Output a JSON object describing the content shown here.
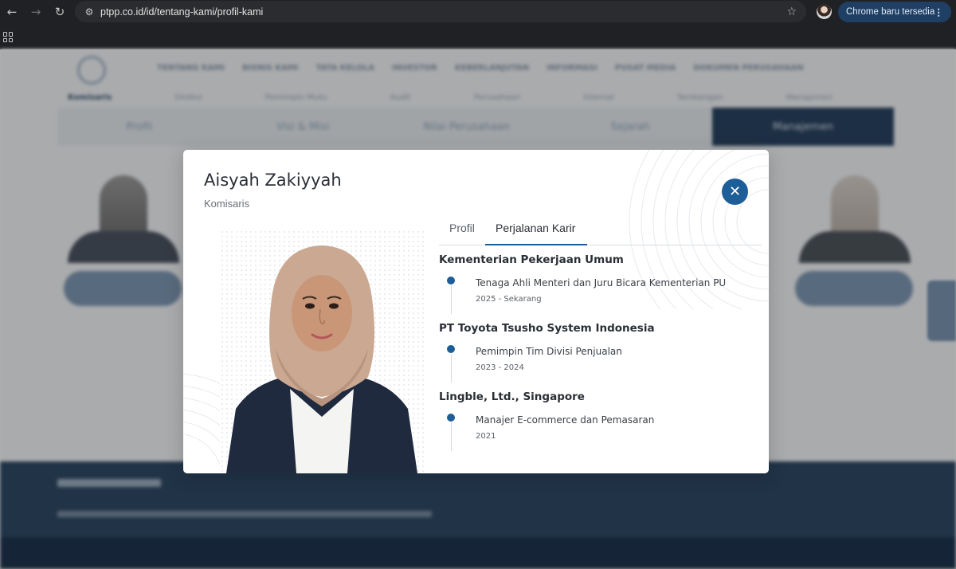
{
  "browser": {
    "url": "ptpp.co.id/id/tentang-kami/profil-kami",
    "update_label": "Chrome baru tersedia"
  },
  "site_nav": {
    "items": [
      "TENTANG KAMI",
      "BISNIS KAMI",
      "TATA KELOLA",
      "INVESTOR",
      "KEBERLANJUTAN",
      "INFORMASI",
      "PUSAT MEDIA",
      "DOKUMEN PERUSAHAAN"
    ],
    "sub_items": [
      "Komisaris",
      "Direksi",
      "Pemimpin Mutu",
      "Audit",
      "Perusahaan",
      "Internal",
      "Tambangan",
      "Manajemen"
    ],
    "tabs": [
      "Profil",
      "Visi & Misi",
      "Nilai Perusahaan",
      "Sejarah",
      "Manajemen"
    ]
  },
  "modal": {
    "name": "Aisyah Zakiyyah",
    "role": "Komisaris",
    "tabs": [
      {
        "label": "Profil",
        "active": false
      },
      {
        "label": "Perjalanan Karir",
        "active": true
      }
    ],
    "career": [
      {
        "company": "Kementerian Pekerjaan Umum",
        "position": "Tenaga Ahli Menteri dan Juru Bicara Kementerian PU",
        "period": "2025 - Sekarang"
      },
      {
        "company": "PT Toyota Tsusho System Indonesia",
        "position": "Pemimpin Tim Divisi Penjualan",
        "period": "2023 - 2024"
      },
      {
        "company": "Lingble, Ltd., Singapore",
        "position": "Manajer E-commerce dan Pemasaran",
        "period": "2021"
      }
    ]
  },
  "colors": {
    "accent": "#1d5d98",
    "nav_dark": "#2a4462",
    "footer": "#2f4a66"
  },
  "icons": {
    "back": "arrow-left-icon",
    "forward": "arrow-right-icon",
    "reload": "reload-icon",
    "site_info": "tune-icon",
    "bookmark": "star-icon",
    "close": "close-icon"
  }
}
